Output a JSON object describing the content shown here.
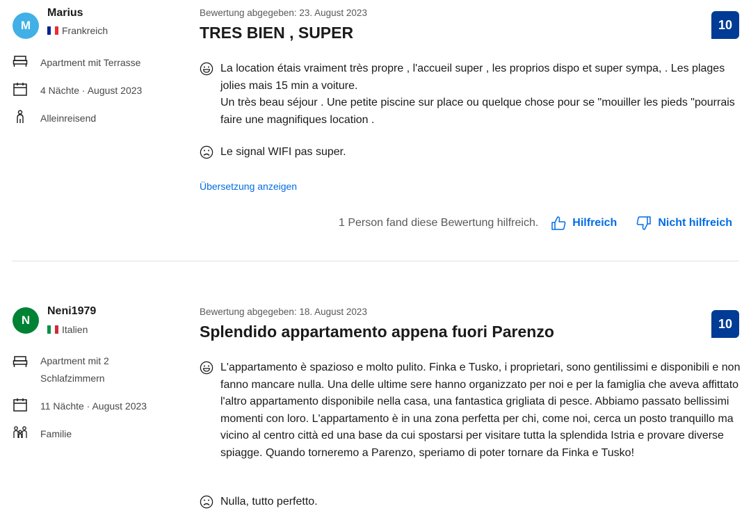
{
  "reviews": [
    {
      "avatar_letter": "M",
      "avatar_color": "#41b0e6",
      "username": "Marius",
      "country": "Frankreich",
      "flag_colors": [
        "#002395",
        "#ffffff",
        "#ed2939"
      ],
      "room": "Apartment mit Terrasse",
      "stay": "4 Nächte · August 2023",
      "traveler_type": "Alleinreisend",
      "traveler_icon": "single-person-icon",
      "date": "Bewertung abgegeben: 23. August 2023",
      "title": "TRES BIEN , SUPER",
      "score": "10",
      "positive": "La location étais vraiment très propre , l'accueil super , les proprios dispo et super sympa, . Les plages jolies mais 15 min a voiture.\nUn très beau séjour . Une petite piscine sur place ou quelque chose pour se \"mouiller les pieds \"pourrais faire une magnifiques location .",
      "negative": "Le signal WIFI pas super.",
      "translate_label": "Übersetzung anzeigen",
      "helpful_count": "1 Person fand diese Bewertung hilfreich.",
      "helpful_label": "Hilfreich",
      "not_helpful_label": "Nicht hilfreich"
    },
    {
      "avatar_letter": "N",
      "avatar_color": "#008234",
      "username": "Neni1979",
      "country": "Italien",
      "flag_colors": [
        "#009246",
        "#ffffff",
        "#ce2b37"
      ],
      "room": "Apartment mit 2 Schlafzimmern",
      "stay": "11 Nächte · August 2023",
      "traveler_type": "Familie",
      "traveler_icon": "family-icon",
      "date": "Bewertung abgegeben: 18. August 2023",
      "title": "Splendido appartamento appena fuori Parenzo",
      "score": "10",
      "positive": "L'appartamento è spazioso e molto pulito. Finka e Tusko, i proprietari, sono gentilissimi e disponibili e non fanno mancare nulla. Una delle ultime sere hanno organizzato per noi e per la famiglia che aveva affittato l'altro appartamento disponibile nella casa, una fantastica grigliata di pesce. Abbiamo passato bellissimi momenti con loro. L'appartamento è in una zona perfetta per chi, come noi, cerca un posto tranquillo ma vicino al centro città ed una base da cui spostarsi per visitare tutta la splendida Istria e provare diverse spiagge. Quando torneremo a Parenzo, speriamo di poter tornare da Finka e Tusko!",
      "negative": "Nulla, tutto perfetto."
    }
  ],
  "colors": {
    "score_bg": "#003b95",
    "link": "#006ce4"
  }
}
